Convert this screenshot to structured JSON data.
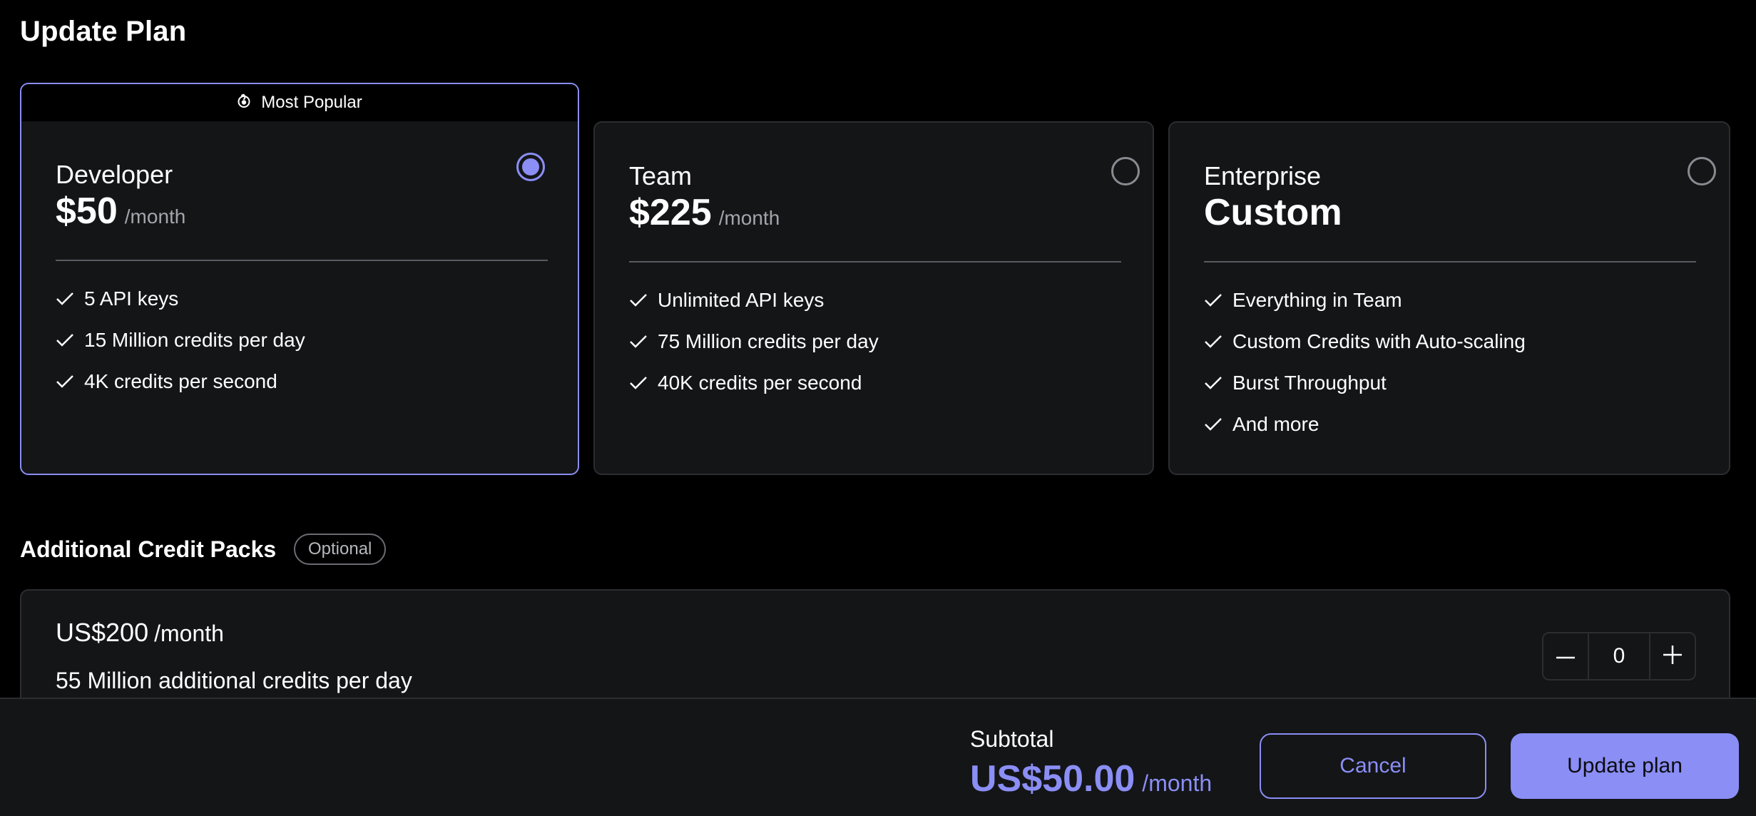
{
  "page": {
    "title": "Update Plan"
  },
  "colors": {
    "accent": "#8a8ef5",
    "card_bg": "#141517",
    "border": "#2c2d31",
    "muted": "#a4a5ab"
  },
  "plans": [
    {
      "name": "Developer",
      "price": "$50",
      "per": "/month",
      "badge": "Most Popular",
      "badge_icon": "flame-icon",
      "selected": true,
      "features": [
        "5 API keys",
        "15 Million credits per day",
        "4K credits per second"
      ]
    },
    {
      "name": "Team",
      "price": "$225",
      "per": "/month",
      "selected": false,
      "features": [
        "Unlimited API keys",
        "75 Million credits per day",
        "40K credits per second"
      ]
    },
    {
      "name": "Enterprise",
      "price": "Custom",
      "selected": false,
      "features": [
        "Everything in Team",
        "Custom Credits with Auto-scaling",
        "Burst Throughput",
        "And more"
      ]
    }
  ],
  "additional": {
    "title": "Additional Credit Packs",
    "badge": "Optional",
    "pack": {
      "price": "US$200",
      "per": "/month",
      "description": "55 Million additional credits per day",
      "quantity": "0"
    }
  },
  "footer": {
    "subtotal_label": "Subtotal",
    "subtotal_amount": "US$50.00",
    "subtotal_per": "/month",
    "cancel_label": "Cancel",
    "update_label": "Update plan"
  }
}
